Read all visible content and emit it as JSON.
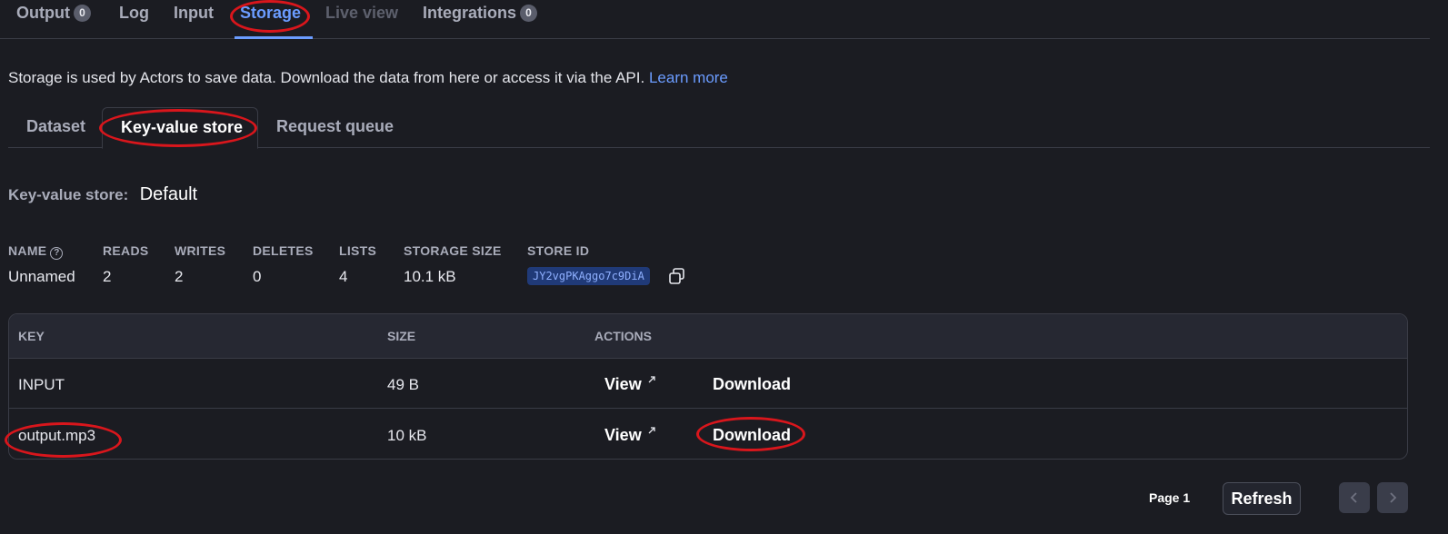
{
  "top_tabs": {
    "output": {
      "label": "Output",
      "count": "0"
    },
    "log": {
      "label": "Log"
    },
    "input": {
      "label": "Input"
    },
    "storage": {
      "label": "Storage"
    },
    "live_view": {
      "label": "Live view"
    },
    "integrations": {
      "label": "Integrations",
      "count": "0"
    }
  },
  "intro": {
    "text": "Storage is used by Actors to save data. Download the data from here or access it via the API.",
    "link": "Learn more"
  },
  "sub_tabs": {
    "dataset": "Dataset",
    "key_value_store": "Key-value store",
    "request_queue": "Request queue"
  },
  "store": {
    "label": "Key-value store:",
    "value": "Default"
  },
  "stats": {
    "headers": {
      "name": "NAME",
      "reads": "READS",
      "writes": "WRITES",
      "deletes": "DELETES",
      "lists": "LISTS",
      "storage_size": "STORAGE SIZE",
      "store_id": "STORE ID"
    },
    "values": {
      "name": "Unnamed",
      "reads": "2",
      "writes": "2",
      "deletes": "0",
      "lists": "4",
      "storage_size": "10.1 kB",
      "store_id": "JY2vgPKAggo7c9DiA"
    }
  },
  "table": {
    "columns": {
      "key": "KEY",
      "size": "SIZE",
      "actions": "ACTIONS"
    },
    "rows": [
      {
        "key": "INPUT",
        "size": "49 B",
        "view": "View",
        "download": "Download"
      },
      {
        "key": "output.mp3",
        "size": "10 kB",
        "view": "View",
        "download": "Download"
      }
    ]
  },
  "footer": {
    "page": "Page 1",
    "refresh": "Refresh"
  },
  "colors": {
    "accent": "#6b9cff",
    "highlight_ring": "#d9161c",
    "background": "#1b1c22"
  },
  "icons": [
    "help-circle-icon",
    "copy-icon",
    "external-link-icon",
    "chevron-left-icon",
    "chevron-right-icon"
  ]
}
